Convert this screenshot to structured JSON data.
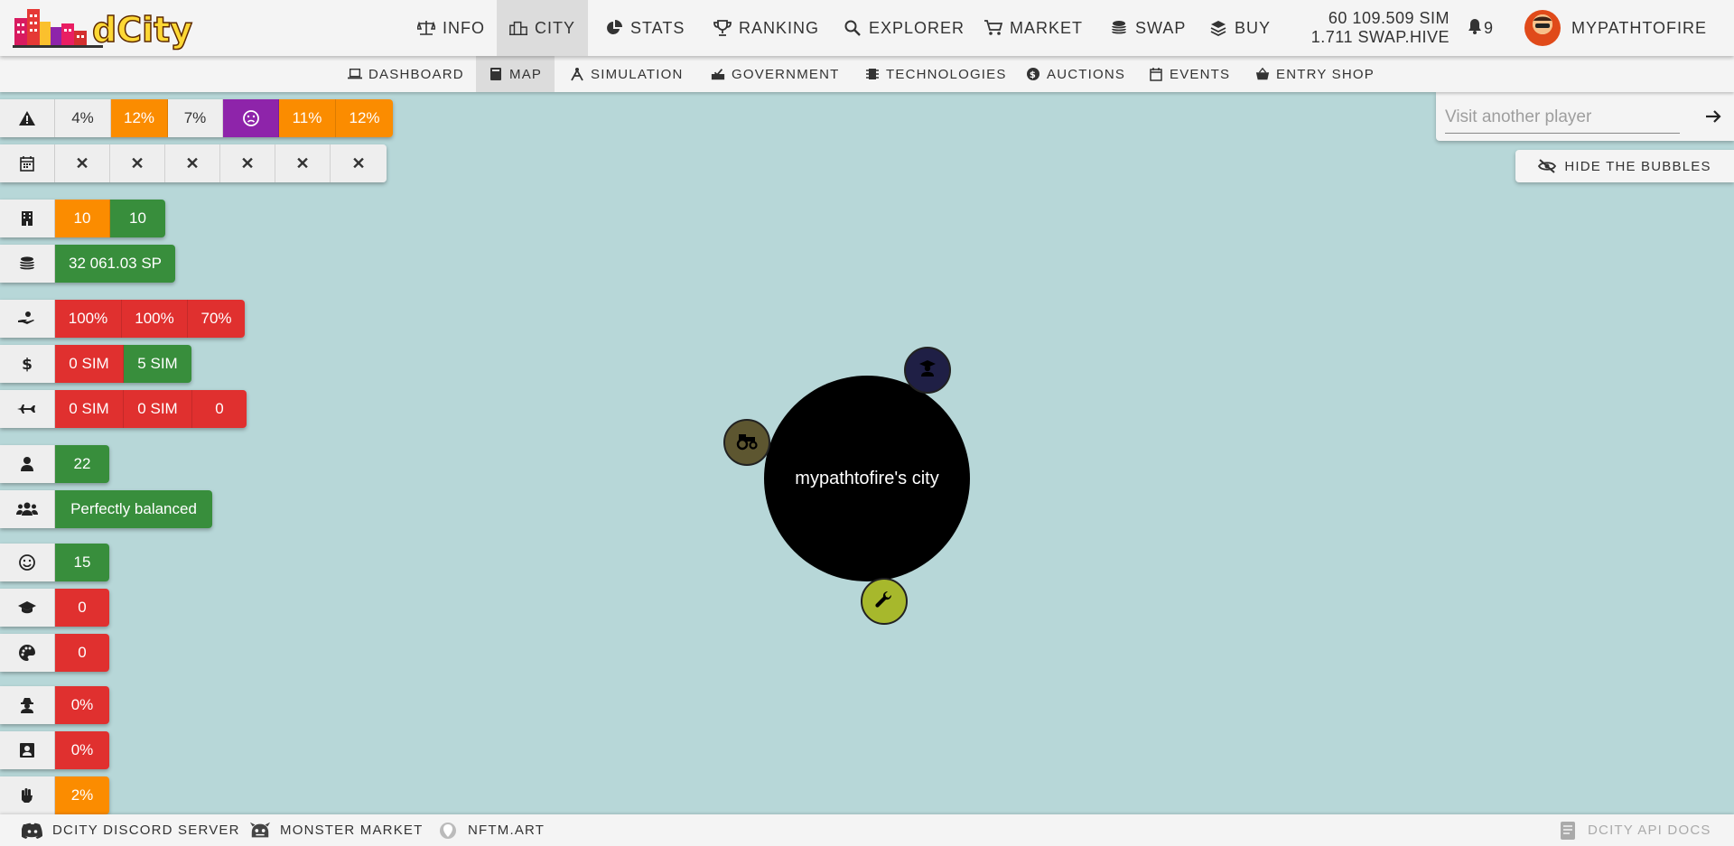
{
  "app": {
    "logo_text": "dCity"
  },
  "nav": [
    {
      "label": "INFO",
      "icon": "scale-icon"
    },
    {
      "label": "CITY",
      "icon": "city-icon"
    },
    {
      "label": "STATS",
      "icon": "pie-chart-icon"
    },
    {
      "label": "RANKING",
      "icon": "trophy-icon"
    },
    {
      "label": "EXPLORER",
      "icon": "search-icon"
    },
    {
      "label": "MARKET",
      "icon": "cart-icon"
    },
    {
      "label": "SWAP",
      "icon": "coins-icon"
    },
    {
      "label": "BUY",
      "icon": "layers-icon"
    }
  ],
  "balance": {
    "sim": "60 109.509 SIM",
    "swap_hive": "1.711 SWAP.HIVE"
  },
  "notifications": {
    "count": "9"
  },
  "user": {
    "name": "MYPATHTOFIRE"
  },
  "subnav": [
    {
      "label": "DASHBOARD",
      "icon": "laptop-icon"
    },
    {
      "label": "MAP",
      "icon": "book-icon"
    },
    {
      "label": "SIMULATION",
      "icon": "compass-icon"
    },
    {
      "label": "GOVERNMENT",
      "icon": "vote-icon"
    },
    {
      "label": "TECHNOLOGIES",
      "icon": "chip-icon"
    },
    {
      "label": "AUCTIONS",
      "icon": "auction-icon"
    },
    {
      "label": "EVENTS",
      "icon": "calendar-icon"
    },
    {
      "label": "ENTRY SHOP",
      "icon": "basket-icon"
    }
  ],
  "stats": {
    "risk": [
      "4%",
      "12%",
      "7%",
      "11%",
      "12%"
    ],
    "events": [
      "✕",
      "✕",
      "✕",
      "✕",
      "✕",
      "✕"
    ],
    "buildings": [
      "10",
      "10"
    ],
    "stake": "32 061.03 SP",
    "income": [
      "100%",
      "100%",
      "70%"
    ],
    "money": [
      "0 SIM",
      "5 SIM"
    ],
    "tourism": [
      "0 SIM",
      "0 SIM",
      "0"
    ],
    "population": "22",
    "workers": "Perfectly balanced",
    "happiness": "15",
    "education": "0",
    "creativity": "0",
    "crime": "0%",
    "judge": "0%",
    "protest": "2%"
  },
  "map": {
    "city_name": "mypathtofire's city"
  },
  "search": {
    "placeholder": "Visit another player"
  },
  "hide_bubbles": {
    "label": "HIDE THE BUBBLES"
  },
  "footer": {
    "discord": "DCITY DISCORD SERVER",
    "monster": "MONSTER MARKET",
    "nftm": "NFTM.ART",
    "api": "DCITY API DOCS"
  },
  "colors": {
    "map_background": "#b7d7d8",
    "orange": "#fb8c00",
    "green": "#388e3c",
    "red": "#e0302f",
    "purple": "#8e24aa"
  }
}
